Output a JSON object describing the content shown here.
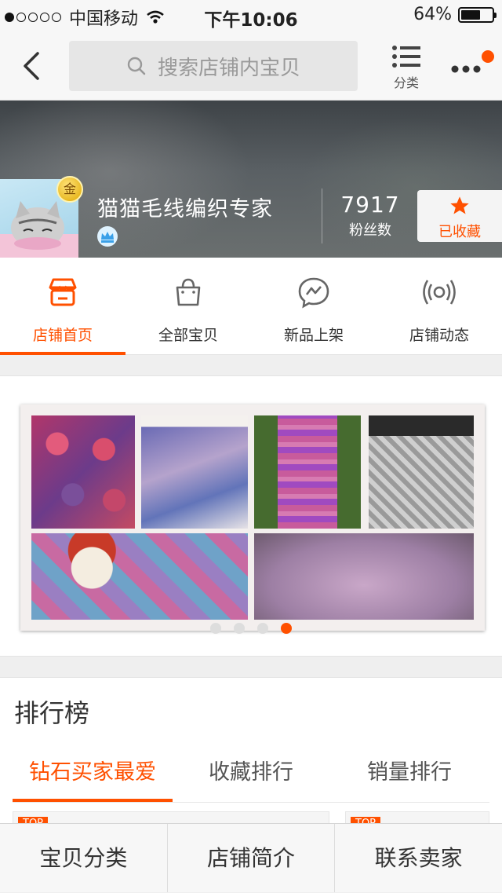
{
  "statusbar": {
    "carrier": "中国移动",
    "time": "下午10:06",
    "battery": "64%",
    "battery_level": 0.64
  },
  "navbar": {
    "search_placeholder": "搜索店铺内宝贝",
    "category_label": "分类"
  },
  "shop": {
    "name": "猫猫毛线编织专家",
    "badge": "金",
    "fans_count": "7917",
    "fans_label": "粉丝数",
    "favorite_label": "已收藏"
  },
  "tabs": [
    {
      "label": "店铺首页",
      "icon": "shop-icon",
      "active": true
    },
    {
      "label": "全部宝贝",
      "icon": "bag-icon",
      "active": false
    },
    {
      "label": "新品上架",
      "icon": "new-items-icon",
      "active": false
    },
    {
      "label": "店铺动态",
      "icon": "broadcast-icon",
      "active": false
    }
  ],
  "carousel": {
    "pages": 4,
    "active_page": 4
  },
  "ranking": {
    "title": "排行榜",
    "tabs": [
      "钻石买家最爱",
      "收藏排行",
      "销量排行"
    ],
    "active_tab": 0,
    "badge": "TOP"
  },
  "bottom_bar": [
    "宝贝分类",
    "店铺简介",
    "联系卖家"
  ],
  "colors": {
    "accent": "#ff5000"
  }
}
